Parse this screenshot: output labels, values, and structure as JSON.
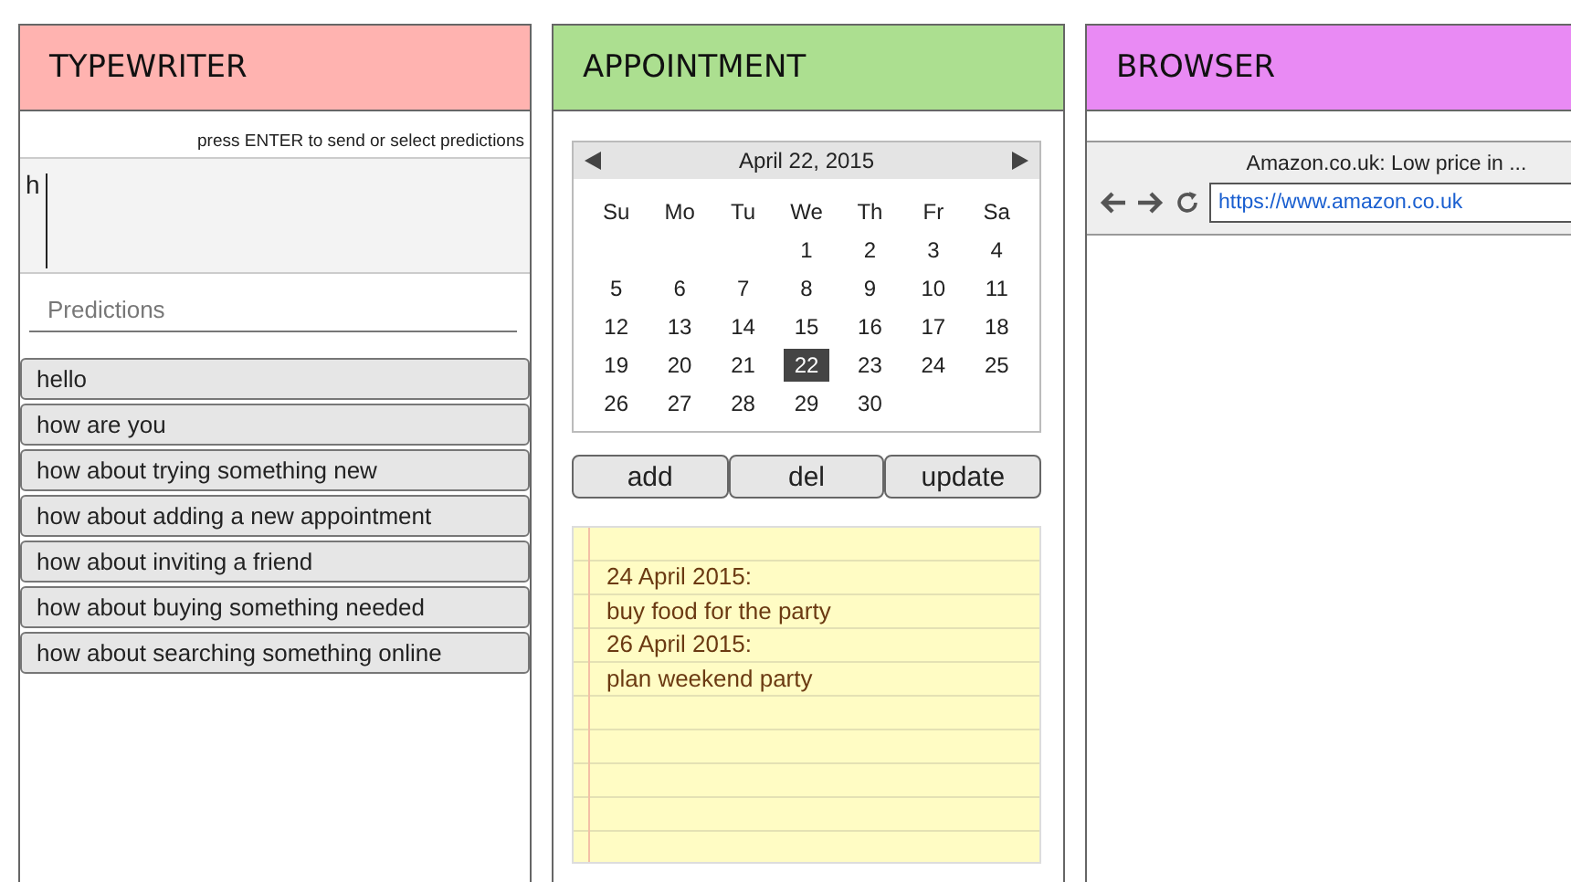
{
  "typewriter": {
    "title": "TYPEWRITER",
    "hint": "press ENTER to send or select predictions",
    "input_value": "h",
    "predictions_placeholder": "Predictions",
    "predictions": [
      "hello",
      "how are you",
      "how about trying something new",
      "how about adding a new appointment",
      "how about inviting a friend",
      "how about buying something needed",
      "how about searching something online"
    ]
  },
  "appointment": {
    "title": "APPOINTMENT",
    "calendar": {
      "title": "April 22, 2015",
      "weekdays": [
        "Su",
        "Mo",
        "Tu",
        "We",
        "Th",
        "Fr",
        "Sa"
      ],
      "weeks": [
        {
          "days": [
            {
              "label": "1",
              "selected": false
            },
            {
              "label": "2",
              "selected": false
            },
            {
              "label": "3",
              "selected": false
            },
            {
              "label": "4",
              "selected": false
            }
          ]
        },
        {
          "days": [
            {
              "label": "5",
              "selected": false
            },
            {
              "label": "6",
              "selected": false
            },
            {
              "label": "7",
              "selected": false
            },
            {
              "label": "8",
              "selected": false
            },
            {
              "label": "9",
              "selected": false
            },
            {
              "label": "10",
              "selected": false
            },
            {
              "label": "11",
              "selected": false
            }
          ]
        },
        {
          "days": [
            {
              "label": "12",
              "selected": false
            },
            {
              "label": "13",
              "selected": false
            },
            {
              "label": "14",
              "selected": false
            },
            {
              "label": "15",
              "selected": false
            },
            {
              "label": "16",
              "selected": false
            },
            {
              "label": "17",
              "selected": false
            },
            {
              "label": "18",
              "selected": false
            }
          ]
        },
        {
          "days": [
            {
              "label": "19",
              "selected": false
            },
            {
              "label": "20",
              "selected": false
            },
            {
              "label": "21",
              "selected": false
            },
            {
              "label": "22",
              "selected": true
            },
            {
              "label": "23",
              "selected": false
            },
            {
              "label": "24",
              "selected": false
            },
            {
              "label": "25",
              "selected": false
            }
          ]
        },
        {
          "days": [
            {
              "label": "26",
              "selected": false
            },
            {
              "label": "27",
              "selected": false
            },
            {
              "label": "28",
              "selected": false
            },
            {
              "label": "29",
              "selected": false
            },
            {
              "label": "30",
              "selected": false
            }
          ]
        }
      ]
    },
    "buttons": [
      "add",
      "del",
      "update"
    ],
    "notes": [
      "24 April 2015:",
      "buy food for the party",
      "26 April 2015:",
      "plan weekend party"
    ]
  },
  "browser": {
    "title": "BROWSER",
    "page_title": "Amazon.co.uk: Low price in ...",
    "url": "https://www.amazon.co.uk"
  }
}
